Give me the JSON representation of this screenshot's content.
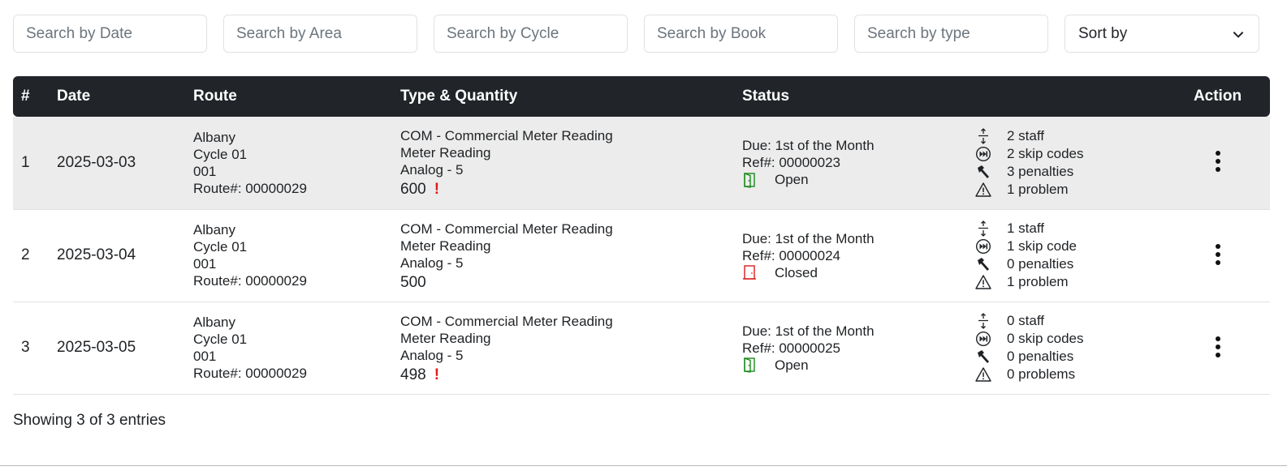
{
  "filters": {
    "date_placeholder": "Search by Date",
    "area_placeholder": "Search by Area",
    "cycle_placeholder": "Search by Cycle",
    "book_placeholder": "Search by Book",
    "type_placeholder": "Search by type",
    "sort_label": "Sort by"
  },
  "table": {
    "headers": {
      "num": "#",
      "date": "Date",
      "route": "Route",
      "type_qty": "Type & Quantity",
      "status": "Status",
      "action": "Action"
    },
    "rows": [
      {
        "num": "1",
        "date": "2025-03-03",
        "area": "Albany",
        "cycle": "Cycle 01",
        "book": "001",
        "route_no": "Route#: 00000029",
        "type_line1": "COM - Commercial Meter Reading",
        "type_line2": "Meter Reading",
        "type_line3": "Analog - 5",
        "quantity": "600",
        "quantity_warning": "!",
        "due": "Due: 1st of the Month",
        "ref": "Ref#: 00000023",
        "state": "Open",
        "state_color": "#1a8a1a",
        "staff": "2 staff",
        "skip_codes": "2 skip codes",
        "penalties": "3 penalties",
        "problems": "1 problem"
      },
      {
        "num": "2",
        "date": "2025-03-04",
        "area": "Albany",
        "cycle": "Cycle 01",
        "book": "001",
        "route_no": "Route#: 00000029",
        "type_line1": "COM - Commercial Meter Reading",
        "type_line2": "Meter Reading",
        "type_line3": "Analog - 5",
        "quantity": "500",
        "quantity_warning": "",
        "due": "Due: 1st of the Month",
        "ref": "Ref#: 00000024",
        "state": "Closed",
        "state_color": "#d91c1c",
        "staff": "1 staff",
        "skip_codes": "1 skip code",
        "penalties": "0 penalties",
        "problems": "1 problem"
      },
      {
        "num": "3",
        "date": "2025-03-05",
        "area": "Albany",
        "cycle": "Cycle 01",
        "book": "001",
        "route_no": "Route#: 00000029",
        "type_line1": "COM - Commercial Meter Reading",
        "type_line2": "Meter Reading",
        "type_line3": "Analog - 5",
        "quantity": "498",
        "quantity_warning": "!",
        "due": "Due: 1st of the Month",
        "ref": "Ref#: 00000025",
        "state": "Open",
        "state_color": "#1a8a1a",
        "staff": "0 staff",
        "skip_codes": "0 skip codes",
        "penalties": "0 penalties",
        "problems": "0 problems"
      }
    ]
  },
  "footer": {
    "summary": "Showing 3 of 3 entries"
  },
  "icons": {
    "staff": "height-arrows-icon",
    "skip": "fast-forward-circle-icon",
    "penalty": "hammer-icon",
    "problem": "warning-triangle-icon",
    "open": "door-open-icon",
    "closed": "door-closed-icon",
    "action": "kebab-menu-icon",
    "sort": "chevron-down-icon"
  },
  "colors": {
    "header_bg": "#212529",
    "row_shaded": "#ececec",
    "warning": "#e01b1b"
  }
}
